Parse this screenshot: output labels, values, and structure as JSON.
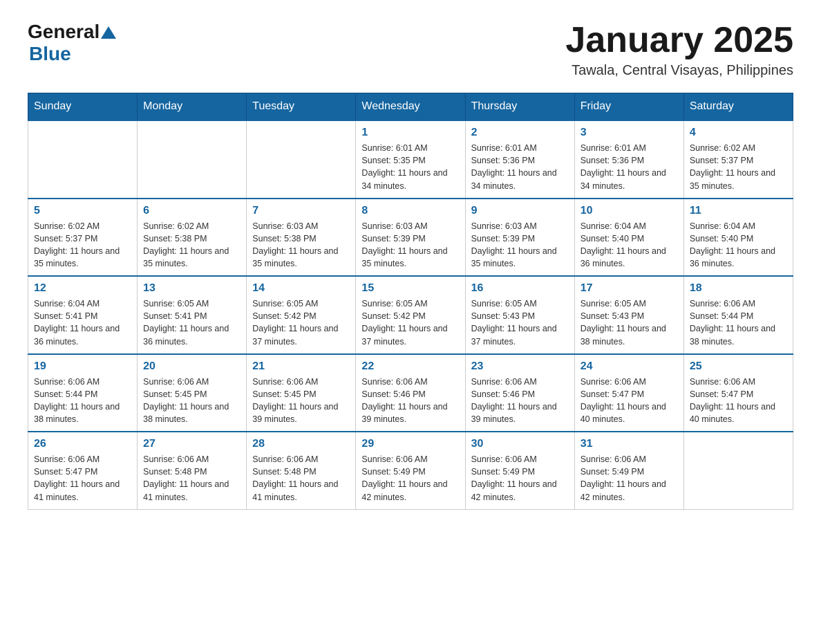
{
  "logo": {
    "general": "General",
    "blue": "Blue",
    "arrow": "▲"
  },
  "title": "January 2025",
  "subtitle": "Tawala, Central Visayas, Philippines",
  "days_of_week": [
    "Sunday",
    "Monday",
    "Tuesday",
    "Wednesday",
    "Thursday",
    "Friday",
    "Saturday"
  ],
  "weeks": [
    [
      {
        "day": "",
        "info": ""
      },
      {
        "day": "",
        "info": ""
      },
      {
        "day": "",
        "info": ""
      },
      {
        "day": "1",
        "info": "Sunrise: 6:01 AM\nSunset: 5:35 PM\nDaylight: 11 hours and 34 minutes."
      },
      {
        "day": "2",
        "info": "Sunrise: 6:01 AM\nSunset: 5:36 PM\nDaylight: 11 hours and 34 minutes."
      },
      {
        "day": "3",
        "info": "Sunrise: 6:01 AM\nSunset: 5:36 PM\nDaylight: 11 hours and 34 minutes."
      },
      {
        "day": "4",
        "info": "Sunrise: 6:02 AM\nSunset: 5:37 PM\nDaylight: 11 hours and 35 minutes."
      }
    ],
    [
      {
        "day": "5",
        "info": "Sunrise: 6:02 AM\nSunset: 5:37 PM\nDaylight: 11 hours and 35 minutes."
      },
      {
        "day": "6",
        "info": "Sunrise: 6:02 AM\nSunset: 5:38 PM\nDaylight: 11 hours and 35 minutes."
      },
      {
        "day": "7",
        "info": "Sunrise: 6:03 AM\nSunset: 5:38 PM\nDaylight: 11 hours and 35 minutes."
      },
      {
        "day": "8",
        "info": "Sunrise: 6:03 AM\nSunset: 5:39 PM\nDaylight: 11 hours and 35 minutes."
      },
      {
        "day": "9",
        "info": "Sunrise: 6:03 AM\nSunset: 5:39 PM\nDaylight: 11 hours and 35 minutes."
      },
      {
        "day": "10",
        "info": "Sunrise: 6:04 AM\nSunset: 5:40 PM\nDaylight: 11 hours and 36 minutes."
      },
      {
        "day": "11",
        "info": "Sunrise: 6:04 AM\nSunset: 5:40 PM\nDaylight: 11 hours and 36 minutes."
      }
    ],
    [
      {
        "day": "12",
        "info": "Sunrise: 6:04 AM\nSunset: 5:41 PM\nDaylight: 11 hours and 36 minutes."
      },
      {
        "day": "13",
        "info": "Sunrise: 6:05 AM\nSunset: 5:41 PM\nDaylight: 11 hours and 36 minutes."
      },
      {
        "day": "14",
        "info": "Sunrise: 6:05 AM\nSunset: 5:42 PM\nDaylight: 11 hours and 37 minutes."
      },
      {
        "day": "15",
        "info": "Sunrise: 6:05 AM\nSunset: 5:42 PM\nDaylight: 11 hours and 37 minutes."
      },
      {
        "day": "16",
        "info": "Sunrise: 6:05 AM\nSunset: 5:43 PM\nDaylight: 11 hours and 37 minutes."
      },
      {
        "day": "17",
        "info": "Sunrise: 6:05 AM\nSunset: 5:43 PM\nDaylight: 11 hours and 38 minutes."
      },
      {
        "day": "18",
        "info": "Sunrise: 6:06 AM\nSunset: 5:44 PM\nDaylight: 11 hours and 38 minutes."
      }
    ],
    [
      {
        "day": "19",
        "info": "Sunrise: 6:06 AM\nSunset: 5:44 PM\nDaylight: 11 hours and 38 minutes."
      },
      {
        "day": "20",
        "info": "Sunrise: 6:06 AM\nSunset: 5:45 PM\nDaylight: 11 hours and 38 minutes."
      },
      {
        "day": "21",
        "info": "Sunrise: 6:06 AM\nSunset: 5:45 PM\nDaylight: 11 hours and 39 minutes."
      },
      {
        "day": "22",
        "info": "Sunrise: 6:06 AM\nSunset: 5:46 PM\nDaylight: 11 hours and 39 minutes."
      },
      {
        "day": "23",
        "info": "Sunrise: 6:06 AM\nSunset: 5:46 PM\nDaylight: 11 hours and 39 minutes."
      },
      {
        "day": "24",
        "info": "Sunrise: 6:06 AM\nSunset: 5:47 PM\nDaylight: 11 hours and 40 minutes."
      },
      {
        "day": "25",
        "info": "Sunrise: 6:06 AM\nSunset: 5:47 PM\nDaylight: 11 hours and 40 minutes."
      }
    ],
    [
      {
        "day": "26",
        "info": "Sunrise: 6:06 AM\nSunset: 5:47 PM\nDaylight: 11 hours and 41 minutes."
      },
      {
        "day": "27",
        "info": "Sunrise: 6:06 AM\nSunset: 5:48 PM\nDaylight: 11 hours and 41 minutes."
      },
      {
        "day": "28",
        "info": "Sunrise: 6:06 AM\nSunset: 5:48 PM\nDaylight: 11 hours and 41 minutes."
      },
      {
        "day": "29",
        "info": "Sunrise: 6:06 AM\nSunset: 5:49 PM\nDaylight: 11 hours and 42 minutes."
      },
      {
        "day": "30",
        "info": "Sunrise: 6:06 AM\nSunset: 5:49 PM\nDaylight: 11 hours and 42 minutes."
      },
      {
        "day": "31",
        "info": "Sunrise: 6:06 AM\nSunset: 5:49 PM\nDaylight: 11 hours and 42 minutes."
      },
      {
        "day": "",
        "info": ""
      }
    ]
  ]
}
